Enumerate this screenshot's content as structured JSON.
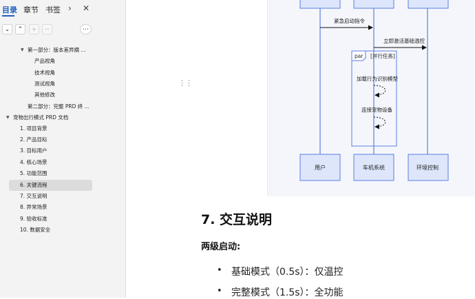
{
  "sidebar": {
    "tabs": [
      "目录",
      "章节",
      "书签"
    ],
    "icons": {
      "next": "chevron-right-icon",
      "close": "close-icon"
    },
    "toc": [
      {
        "label": "第一部分：版本差异摘 ...",
        "level": 2,
        "caret": "▼"
      },
      {
        "label": "产品视角",
        "level": 3
      },
      {
        "label": "技术视角",
        "level": 3
      },
      {
        "label": "测试视角",
        "level": 3
      },
      {
        "label": "其他修改",
        "level": 3
      },
      {
        "label": "第二部分：完整 PRD 终 ...",
        "level": 2
      },
      {
        "label": "宠物出行模式 PRD 文档",
        "level": 1,
        "caret": "▼"
      },
      {
        "label": "1. 项目背景",
        "level": 2
      },
      {
        "label": "2. 产品目标",
        "level": 2
      },
      {
        "label": "3. 目标用户",
        "level": 2
      },
      {
        "label": "4. 核心场景",
        "level": 2
      },
      {
        "label": "5. 功能范围",
        "level": 2
      },
      {
        "label": "6. 关键流程",
        "level": 2,
        "selected": true
      },
      {
        "label": "7. 交互说明",
        "level": 2
      },
      {
        "label": "8. 异常场景",
        "level": 2
      },
      {
        "label": "9. 验收标准",
        "level": 2
      },
      {
        "label": "10. 数据安全",
        "level": 2
      }
    ]
  },
  "diagram": {
    "messages": [
      "紧急启动指令",
      "立即激活基础温控"
    ],
    "par_label": "par",
    "par_title": "[并行任务]",
    "self_calls": [
      "加载行为识别模型",
      "连接宠物设备"
    ],
    "participants": [
      "用户",
      "车机系统",
      "环境控制"
    ]
  },
  "content": {
    "heading": "7. 交互说明",
    "subheading": "两级启动:",
    "bullets": [
      "基础模式（0.5s）：仅温控",
      "完整模式（1.5s）：全功能"
    ]
  },
  "colors": {
    "accent": "#1f5fbf",
    "diagram_line": "#5b7ee0"
  }
}
